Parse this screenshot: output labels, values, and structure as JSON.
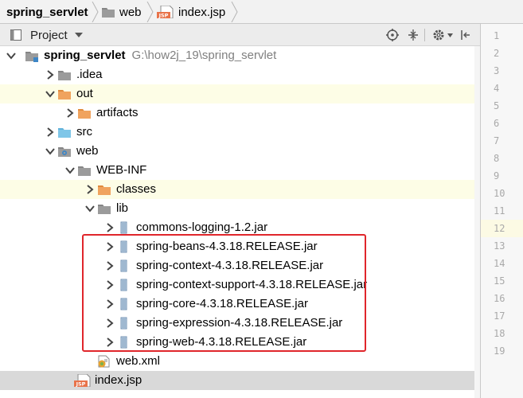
{
  "breadcrumb": {
    "items": [
      {
        "label": "spring_servlet",
        "bold": true,
        "icon": "folder-icon"
      },
      {
        "label": "web",
        "bold": false,
        "icon": "folder-icon"
      },
      {
        "label": "index.jsp",
        "bold": false,
        "icon": "jsp-file-icon"
      }
    ]
  },
  "toolbar": {
    "view_label": "Project",
    "icons": [
      "locate-target-icon",
      "collapse-all-icon",
      "gear-icon",
      "hide-panel-icon"
    ]
  },
  "tree": [
    {
      "label": "spring_servlet",
      "path": "G:\\how2j_19\\spring_servlet",
      "bold": true,
      "icon": "module-folder",
      "expanded": true,
      "depth": 0,
      "highlight": ""
    },
    {
      "label": ".idea",
      "icon": "folder-gray",
      "expanded": false,
      "depth": 1,
      "highlight": ""
    },
    {
      "label": "out",
      "icon": "folder-orange",
      "expanded": true,
      "depth": 1,
      "highlight": "yellow"
    },
    {
      "label": "artifacts",
      "icon": "folder-orange",
      "expanded": false,
      "depth": 2,
      "highlight": ""
    },
    {
      "label": "src",
      "icon": "folder-blue",
      "expanded": false,
      "depth": 1,
      "highlight": ""
    },
    {
      "label": "web",
      "icon": "folder-web",
      "expanded": true,
      "depth": 1,
      "highlight": ""
    },
    {
      "label": "WEB-INF",
      "icon": "folder-gray",
      "expanded": true,
      "depth": 2,
      "highlight": ""
    },
    {
      "label": "classes",
      "icon": "folder-orange",
      "expanded": false,
      "depth": 3,
      "highlight": "yellow"
    },
    {
      "label": "lib",
      "icon": "folder-gray",
      "expanded": true,
      "depth": 3,
      "highlight": ""
    },
    {
      "label": "commons-logging-1.2.jar",
      "icon": "jar",
      "expanded": false,
      "depth": 4,
      "highlight": ""
    },
    {
      "label": "spring-beans-4.3.18.RELEASE.jar",
      "icon": "jar",
      "expanded": false,
      "depth": 4,
      "highlight": ""
    },
    {
      "label": "spring-context-4.3.18.RELEASE.jar",
      "icon": "jar",
      "expanded": false,
      "depth": 4,
      "highlight": ""
    },
    {
      "label": "spring-context-support-4.3.18.RELEASE.jar",
      "icon": "jar",
      "expanded": false,
      "depth": 4,
      "highlight": ""
    },
    {
      "label": "spring-core-4.3.18.RELEASE.jar",
      "icon": "jar",
      "expanded": false,
      "depth": 4,
      "highlight": ""
    },
    {
      "label": "spring-expression-4.3.18.RELEASE.jar",
      "icon": "jar",
      "expanded": false,
      "depth": 4,
      "highlight": ""
    },
    {
      "label": "spring-web-4.3.18.RELEASE.jar",
      "icon": "jar",
      "expanded": false,
      "depth": 4,
      "highlight": ""
    },
    {
      "label": "web.xml",
      "icon": "web-xml",
      "expanded": null,
      "depth": 3,
      "highlight": ""
    },
    {
      "label": "index.jsp",
      "icon": "jsp",
      "expanded": null,
      "depth": 2,
      "highlight": "gray"
    }
  ],
  "line_numbers": [
    "1",
    "2",
    "3",
    "4",
    "5",
    "6",
    "7",
    "8",
    "9",
    "10",
    "11",
    "12",
    "13",
    "14",
    "15",
    "16",
    "17",
    "18",
    "19"
  ],
  "current_line": "12",
  "colors": {
    "selection_box": "#e0262b",
    "folder_orange": "#f0a35e",
    "folder_blue": "#7fc6e8"
  }
}
